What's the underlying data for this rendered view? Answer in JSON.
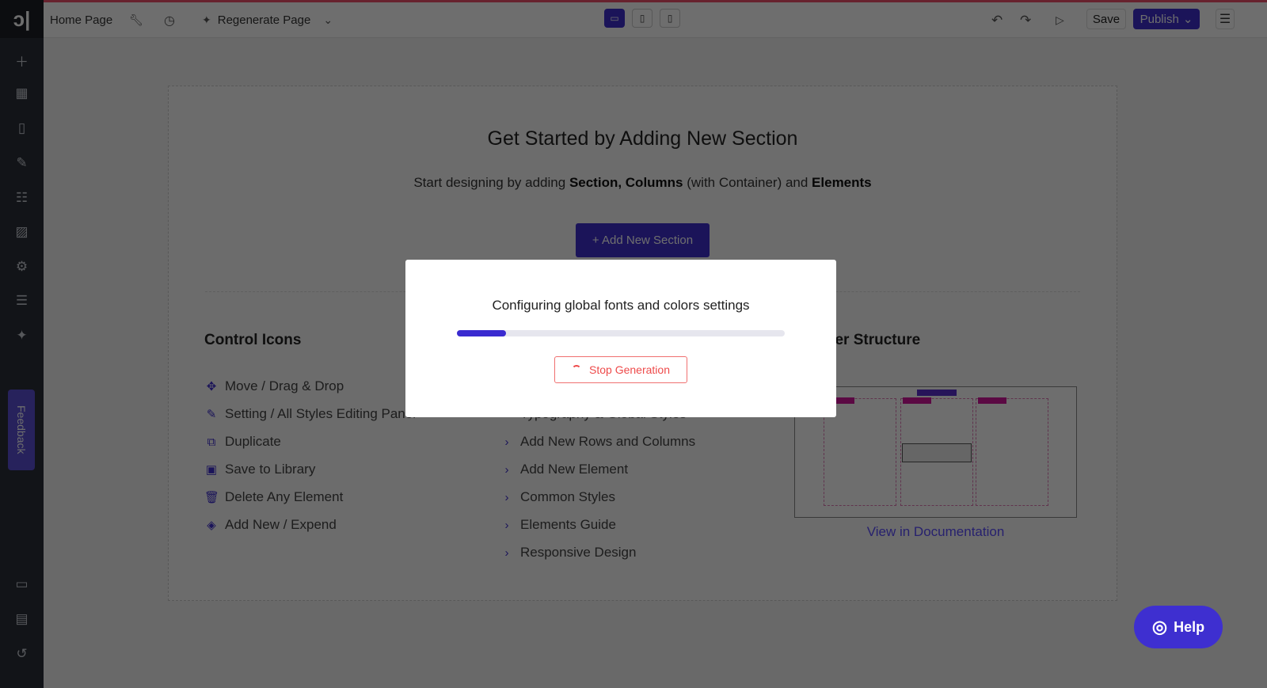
{
  "topbar": {
    "page_name": "Home Page",
    "regenerate_label": "Regenerate Page",
    "save_label": "Save",
    "publish_label": "Publish"
  },
  "sidebar": {
    "feedback_label": "Feedback"
  },
  "canvas": {
    "title": "Get Started by Adding New Section",
    "subtitle": {
      "prefix": "Start designing by adding ",
      "b1": "Section, Columns",
      "mid": " (with Container) and ",
      "b2": "Elements"
    },
    "add_section_label": "+ Add New Section",
    "control_icons": {
      "heading": "Control Icons",
      "items": [
        "Move / Drag & Drop",
        "Setting / All Styles Editing Panel",
        "Duplicate",
        "Save to Library",
        "Delete Any Element",
        "Add New / Expend"
      ]
    },
    "links": {
      "items": [
        "Typography & Global Styles",
        "Add New Rows and Columns",
        "Add New Element",
        "Common Styles",
        "Elements Guide",
        "Responsive Design"
      ]
    },
    "structure": {
      "heading": "Builder Structure",
      "doc_link": "View in Documentation"
    }
  },
  "modal": {
    "message": "Configuring global fonts and colors settings",
    "progress_percent": 15,
    "stop_label": "Stop Generation"
  },
  "help": {
    "label": "Help"
  },
  "colors": {
    "accent": "#3e2fd0",
    "stop": "#ee4b4b"
  }
}
